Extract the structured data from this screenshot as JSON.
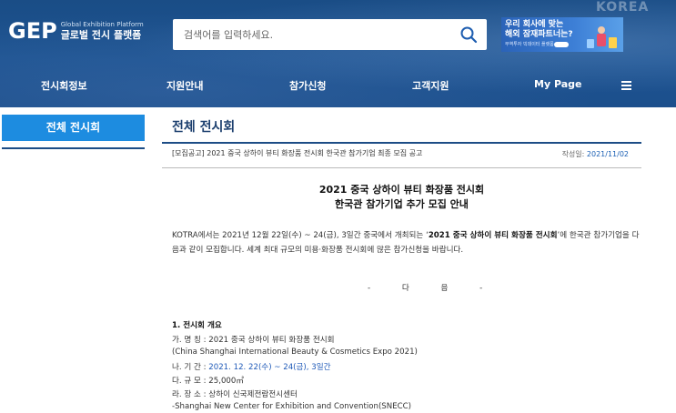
{
  "header": {
    "logo_mark": "GEP",
    "logo_en": "Global Exhibition Platform",
    "logo_ko": "글로벌 전시 플랫폼",
    "search_placeholder": "검색어를 입력하세요.",
    "banner": {
      "line1": "우리 회사에 맞는",
      "line2": "해외 잠재파트너는?",
      "line3": "무역투자 빅데이터 플랫폼",
      "bg_text": "KOREA"
    },
    "nav": [
      {
        "label": "전시회정보"
      },
      {
        "label": "지원안내"
      },
      {
        "label": "참가신청"
      },
      {
        "label": "고객지원"
      },
      {
        "label": "My Page"
      }
    ]
  },
  "sidebar": {
    "active_item": "전체 전시회"
  },
  "main": {
    "page_title": "전체 전시회",
    "post": {
      "subject": "[모집공고] 2021 중국 상하이 뷰티 화장품 전시회 한국관 참가기업 최종 모집 공고",
      "date_label": "작성일:",
      "date_value": "2021/11/02"
    },
    "headline1": "2021 중국 상하이 뷰티 화장품 전시회",
    "headline2": "한국관 참가기업 추가 모집 안내",
    "intro_pre": "KOTRA에서는 2021년 12월 22일(수) ~ 24(금), 3일간 중국에서 개최되는 ‘",
    "intro_bold": "2021 중국 상하이 뷰티 화장품 전시회",
    "intro_post": "’에 한국관 참가기업을 다음과 같이 모집합니다. 세계 최대 규모의 미용·화장품 전시회에 많은 참가신청을 바랍니다.",
    "da_um": "- 다 음 -",
    "section1_title": "1. 전시회 개요",
    "overview": {
      "name_label": "가. 명 칭 : ",
      "name_value": "2021 중국 상하이 뷰티 화장품 전시회",
      "name_en": "(China Shanghai International Beauty & Cosmetics Expo 2021)",
      "period_label": "나. 기 간 : ",
      "period_value": "2021. 12. 22(수) ~ 24(금), 3일간",
      "scale_label": "다. 규 모 : ",
      "scale_value": "25,000㎡",
      "venue_label": "라. 장 소 : ",
      "venue_value": "상하이 신국제전람전시센터",
      "venue_en": "-Shanghai New Center for Exhibition and Convention(SNECC)"
    }
  },
  "colors": {
    "header_blue": "#1d5391",
    "sidebar_active": "#1d8ce0",
    "title_navy": "#1c3f6e",
    "link_blue": "#1f5ab8"
  },
  "icons": {
    "search": "search-icon",
    "menu": "hamburger-menu-icon"
  }
}
